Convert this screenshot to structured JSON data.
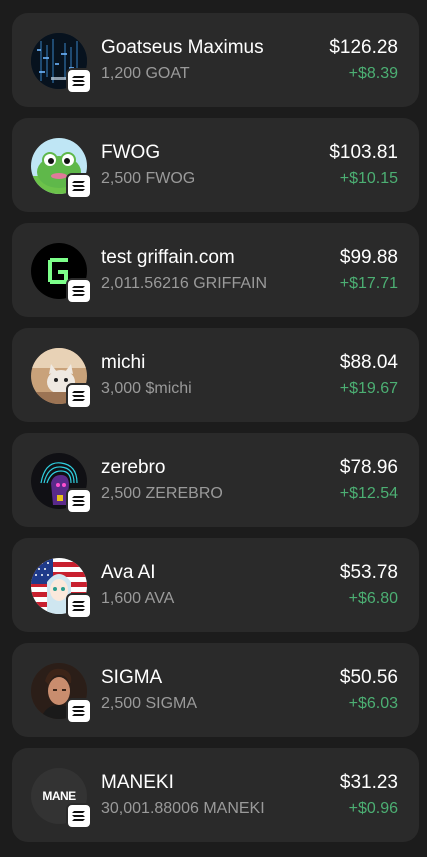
{
  "colors": {
    "background": "#1c1c1c",
    "card": "#2a2a2a",
    "primary_text": "#ffffff",
    "secondary_text": "#9a9a9a",
    "positive": "#4caf73"
  },
  "tokens": [
    {
      "name": "Goatseus Maximus",
      "amount": "1,200 GOAT",
      "value": "$126.28",
      "change": "+$8.39",
      "icon": "goat-token-icon"
    },
    {
      "name": "FWOG",
      "amount": "2,500 FWOG",
      "value": "$103.81",
      "change": "+$10.15",
      "icon": "fwog-token-icon"
    },
    {
      "name": "test griffain.com",
      "amount": "2,011.56216 GRIFFAIN",
      "value": "$99.88",
      "change": "+$17.71",
      "icon": "griffain-token-icon"
    },
    {
      "name": "michi",
      "amount": "3,000 $michi",
      "value": "$88.04",
      "change": "+$19.67",
      "icon": "michi-token-icon"
    },
    {
      "name": "zerebro",
      "amount": "2,500 ZEREBRO",
      "value": "$78.96",
      "change": "+$12.54",
      "icon": "zerebro-token-icon"
    },
    {
      "name": "Ava AI",
      "amount": "1,600 AVA",
      "value": "$53.78",
      "change": "+$6.80",
      "icon": "ava-token-icon"
    },
    {
      "name": "SIGMA",
      "amount": "2,500 SIGMA",
      "value": "$50.56",
      "change": "+$6.03",
      "icon": "sigma-token-icon"
    },
    {
      "name": "MANEKI",
      "amount": "30,001.88006 MANEKI",
      "value": "$31.23",
      "change": "+$0.96",
      "icon": "maneki-token-icon",
      "icon_text": "MANE"
    }
  ]
}
